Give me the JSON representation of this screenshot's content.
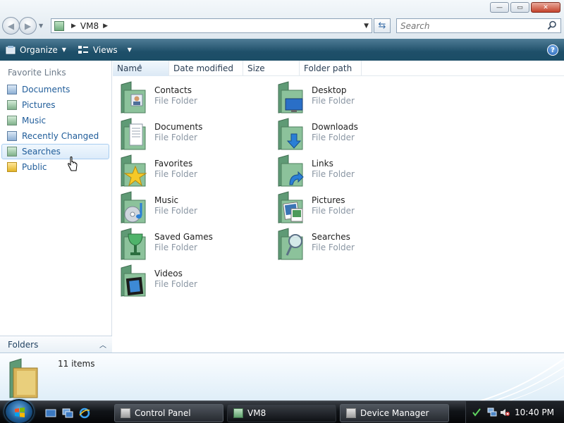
{
  "window": {
    "minimize_symbol": "—",
    "maximize_symbol": "▭",
    "close_symbol": "✕"
  },
  "address": {
    "path": "VM8",
    "search_placeholder": "Search"
  },
  "toolbar": {
    "organize_label": "Organize",
    "views_label": "Views",
    "help_symbol": "?"
  },
  "sidebar": {
    "title": "Favorite Links",
    "items": [
      {
        "label": "Documents",
        "icon": "documents-icon"
      },
      {
        "label": "Pictures",
        "icon": "pictures-icon"
      },
      {
        "label": "Music",
        "icon": "music-icon"
      },
      {
        "label": "Recently Changed",
        "icon": "recently-changed-icon"
      },
      {
        "label": "Searches",
        "icon": "searches-icon"
      },
      {
        "label": "Public",
        "icon": "public-folder-icon"
      }
    ],
    "folders_label": "Folders"
  },
  "columns": [
    "Name",
    "Date modified",
    "Size",
    "Folder path"
  ],
  "items": [
    {
      "name": "Contacts",
      "type": "File Folder",
      "icon": "contacts-folder-icon"
    },
    {
      "name": "Desktop",
      "type": "File Folder",
      "icon": "desktop-folder-icon"
    },
    {
      "name": "Documents",
      "type": "File Folder",
      "icon": "documents-folder-icon"
    },
    {
      "name": "Downloads",
      "type": "File Folder",
      "icon": "downloads-folder-icon"
    },
    {
      "name": "Favorites",
      "type": "File Folder",
      "icon": "favorites-folder-icon"
    },
    {
      "name": "Links",
      "type": "File Folder",
      "icon": "links-folder-icon"
    },
    {
      "name": "Music",
      "type": "File Folder",
      "icon": "music-folder-icon"
    },
    {
      "name": "Pictures",
      "type": "File Folder",
      "icon": "pictures-folder-icon"
    },
    {
      "name": "Saved Games",
      "type": "File Folder",
      "icon": "saved-games-folder-icon"
    },
    {
      "name": "Searches",
      "type": "File Folder",
      "icon": "searches-folder-icon"
    },
    {
      "name": "Videos",
      "type": "File Folder",
      "icon": "videos-folder-icon"
    }
  ],
  "details": {
    "item_count": "11 items"
  },
  "taskbar": {
    "buttons": [
      {
        "label": "Control Panel"
      },
      {
        "label": "VM8"
      },
      {
        "label": "Device Manager"
      }
    ],
    "clock": "10:40 PM"
  },
  "colors": {
    "toolbar_dark": "#1e4f69",
    "link_blue": "#1f5c99",
    "folder_green": "#7fb18a",
    "taskbar_black": "#111418"
  }
}
